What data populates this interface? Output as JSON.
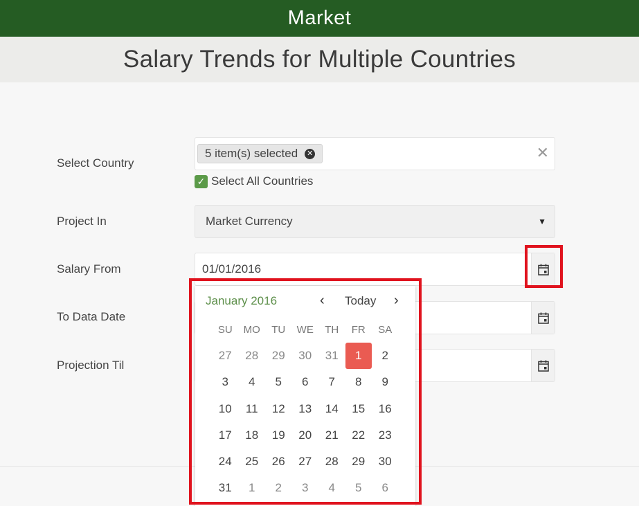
{
  "header": {
    "title": "Market"
  },
  "page": {
    "subtitle": "Salary Trends for Multiple Countries"
  },
  "form": {
    "country": {
      "label": "Select Country",
      "chip": "5 item(s) selected",
      "clear": "✕",
      "select_all_label": "Select All Countries",
      "select_all_checked": true
    },
    "project_in": {
      "label": "Project In",
      "value": "Market Currency"
    },
    "salary_from": {
      "label": "Salary From",
      "value": "01/01/2016"
    },
    "to_data_date": {
      "label": "To Data Date",
      "value": ""
    },
    "projection_til": {
      "label": "Projection Til",
      "value": ""
    }
  },
  "calendar": {
    "month_label": "January 2016",
    "prev": "‹",
    "today_label": "Today",
    "next": "›",
    "weekdays": [
      "SU",
      "MO",
      "TU",
      "WE",
      "TH",
      "FR",
      "SA"
    ],
    "weeks": [
      [
        "27",
        "28",
        "29",
        "30",
        "31",
        "1",
        "2"
      ],
      [
        "3",
        "4",
        "5",
        "6",
        "7",
        "8",
        "9"
      ],
      [
        "10",
        "11",
        "12",
        "13",
        "14",
        "15",
        "16"
      ],
      [
        "17",
        "18",
        "19",
        "20",
        "21",
        "22",
        "23"
      ],
      [
        "24",
        "25",
        "26",
        "27",
        "28",
        "29",
        "30"
      ],
      [
        "31",
        "1",
        "2",
        "3",
        "4",
        "5",
        "6"
      ]
    ],
    "selected": "1",
    "colors": {
      "accent": "#ea5b52",
      "month": "#5d8f4a"
    }
  },
  "colors": {
    "brand": "#255c23",
    "highlight": "#e0131e",
    "checkbox": "#5b9a48"
  },
  "icons": {
    "calendar": "calendar-icon",
    "chip_remove": "close-circle-icon",
    "dropdown": "caret-down-icon"
  }
}
